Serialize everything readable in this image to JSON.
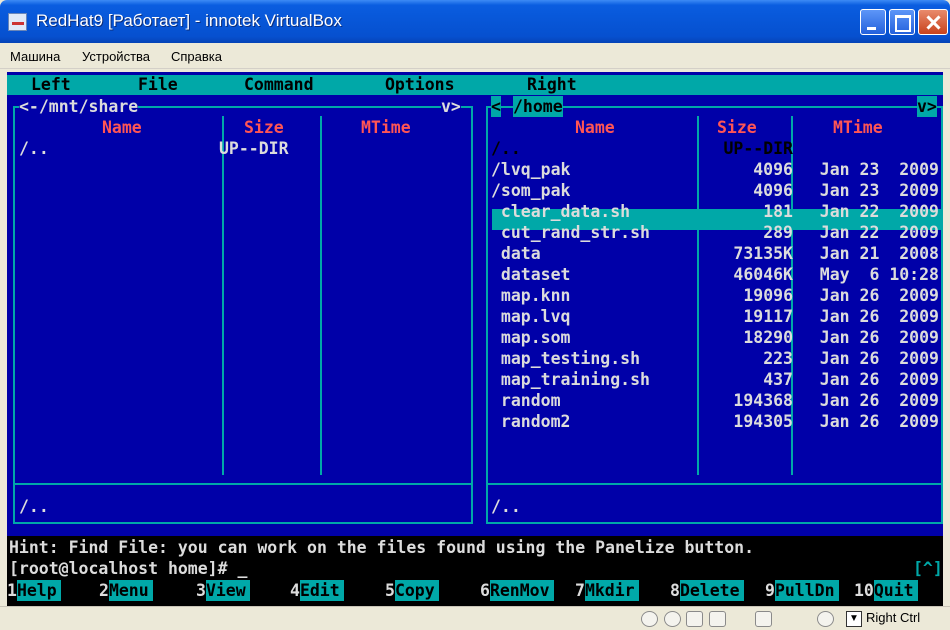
{
  "window": {
    "title": "RedHat9 [Работает] - innotek VirtualBox"
  },
  "vbox_menu": [
    "Машина",
    "Устройства",
    "Справка"
  ],
  "mc_menu": [
    "Left",
    "File",
    "Command",
    "Options",
    "Right"
  ],
  "left_panel": {
    "path": "<-/mnt/share",
    "scroll_marker": "v>",
    "columns": [
      "Name",
      "Size",
      "MTime"
    ],
    "rows": [
      {
        "name": "/..",
        "size": "UP--DIR",
        "mtime": ""
      }
    ],
    "mini_status": "/.."
  },
  "right_panel": {
    "path_left_marker": "<",
    "path": "/home",
    "scroll_marker": "v>",
    "columns": [
      "Name",
      "Size",
      "MTime"
    ],
    "rows": [
      {
        "name": "/..",
        "size": "UP--DIR",
        "mtime": ""
      },
      {
        "name": "/lvq_pak",
        "size": "4096",
        "mtime": "Jan 23  2009"
      },
      {
        "name": "/som_pak",
        "size": "4096",
        "mtime": "Jan 23  2009"
      },
      {
        "name": " clear_data.sh",
        "size": "181",
        "mtime": "Jan 22  2009"
      },
      {
        "name": " cut_rand_str.sh",
        "size": "289",
        "mtime": "Jan 22  2009"
      },
      {
        "name": " data",
        "size": "73135K",
        "mtime": "Jan 21  2008"
      },
      {
        "name": " dataset",
        "size": "46046K",
        "mtime": "May  6 10:28"
      },
      {
        "name": " map.knn",
        "size": "19096",
        "mtime": "Jan 26  2009"
      },
      {
        "name": " map.lvq",
        "size": "19117",
        "mtime": "Jan 26  2009"
      },
      {
        "name": " map.som",
        "size": "18290",
        "mtime": "Jan 26  2009"
      },
      {
        "name": " map_testing.sh",
        "size": "223",
        "mtime": "Jan 26  2009"
      },
      {
        "name": " map_training.sh",
        "size": "437",
        "mtime": "Jan 26  2009"
      },
      {
        "name": " random",
        "size": "194368",
        "mtime": "Jan 26  2009"
      },
      {
        "name": " random2",
        "size": "194305",
        "mtime": "Jan 26  2009"
      }
    ],
    "mini_status": "/.."
  },
  "hint": "Hint: Find File: you can work on the files found using the Panelize button.",
  "prompt": "[root@localhost home]# _",
  "prompt_marker": "[^]",
  "fkeys": [
    {
      "num": "1",
      "label": "Help"
    },
    {
      "num": "2",
      "label": "Menu"
    },
    {
      "num": "3",
      "label": "View"
    },
    {
      "num": "4",
      "label": "Edit"
    },
    {
      "num": "5",
      "label": "Copy"
    },
    {
      "num": "6",
      "label": "RenMov"
    },
    {
      "num": "7",
      "label": "Mkdir"
    },
    {
      "num": "8",
      "label": "Delete"
    },
    {
      "num": "9",
      "label": "PullDn"
    },
    {
      "num": "10",
      "label": "Quit"
    }
  ],
  "status_bar": {
    "host_key": "Right Ctrl"
  },
  "colors": {
    "mc_blue": "#0000a8",
    "mc_cyan": "#00a8a8",
    "mc_header": "#ff5555",
    "xp_title": "#0755d6"
  }
}
